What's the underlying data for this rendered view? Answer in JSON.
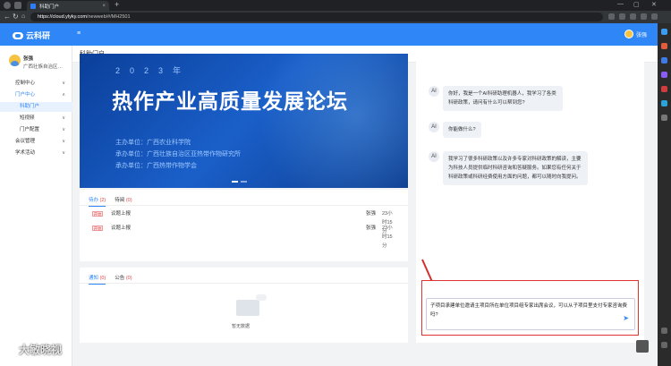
{
  "browser": {
    "tab_title": "科助门户",
    "url_host": "https://cloud.ylyky.com",
    "url_path": "/newweb/#/MH2501"
  },
  "app": {
    "logo_text": "云科研",
    "menu_toggle": "≡",
    "user_name": "张强"
  },
  "sidebar": {
    "profile_name": "张强",
    "profile_org": "广西壮族自治区…",
    "items": [
      {
        "label": "控制中心",
        "chev": "∨"
      },
      {
        "label": "门户中心",
        "chev": "∧"
      },
      {
        "label": "科助门户",
        "chev": ""
      },
      {
        "label": "短视频",
        "chev": "∨"
      },
      {
        "label": "门户配置",
        "chev": "∨"
      },
      {
        "label": "会议管理",
        "chev": "∨"
      },
      {
        "label": "学术活动",
        "chev": "∨"
      }
    ]
  },
  "breadcrumb": "科助门户",
  "banner": {
    "year": "2023年",
    "title": "热作产业高质量发展论坛",
    "lines": [
      "主办单位：广西农业科学院",
      "承办单位：广西壮族自治区亚热带作物研究所",
      "承办单位：广西热带作物学会"
    ]
  },
  "todo": {
    "tab_todo": "待办",
    "tab_todo_count": "(2)",
    "tab_read": "待阅",
    "tab_read_count": "(0)",
    "rows": [
      {
        "tag": "开始",
        "text": "议题上报",
        "who": "张强",
        "time": "23小时15分"
      },
      {
        "tag": "开始",
        "text": "议题上报",
        "who": "张强",
        "time": "23小时15分"
      }
    ]
  },
  "notice": {
    "tab_notice": "通知",
    "tab_notice_count": "(0)",
    "tab_announce": "公告",
    "tab_announce_count": "(0)",
    "empty_text": "暂无数据"
  },
  "chat": {
    "avatar": "AI",
    "messages": [
      "你好，我是一个AI科研助理机器人，我学习了各类科研政策，请问有什么可以帮到您?",
      "你能做什么?",
      "我学习了很多科研政策以及许多专家对科研政策的解读，主要为科技人员提供临时科研咨询和答疑服务。如果您有任何关于科研政策或科研经费使用方面的问题，都可以随时向我提问。"
    ],
    "input_text": "子项目承建单位邀请主项目所在单位项目组专家出席会议，可以从子项目里支付专家咨询费吗?",
    "send_icon": "➤"
  },
  "watermark": "大敏晓视"
}
